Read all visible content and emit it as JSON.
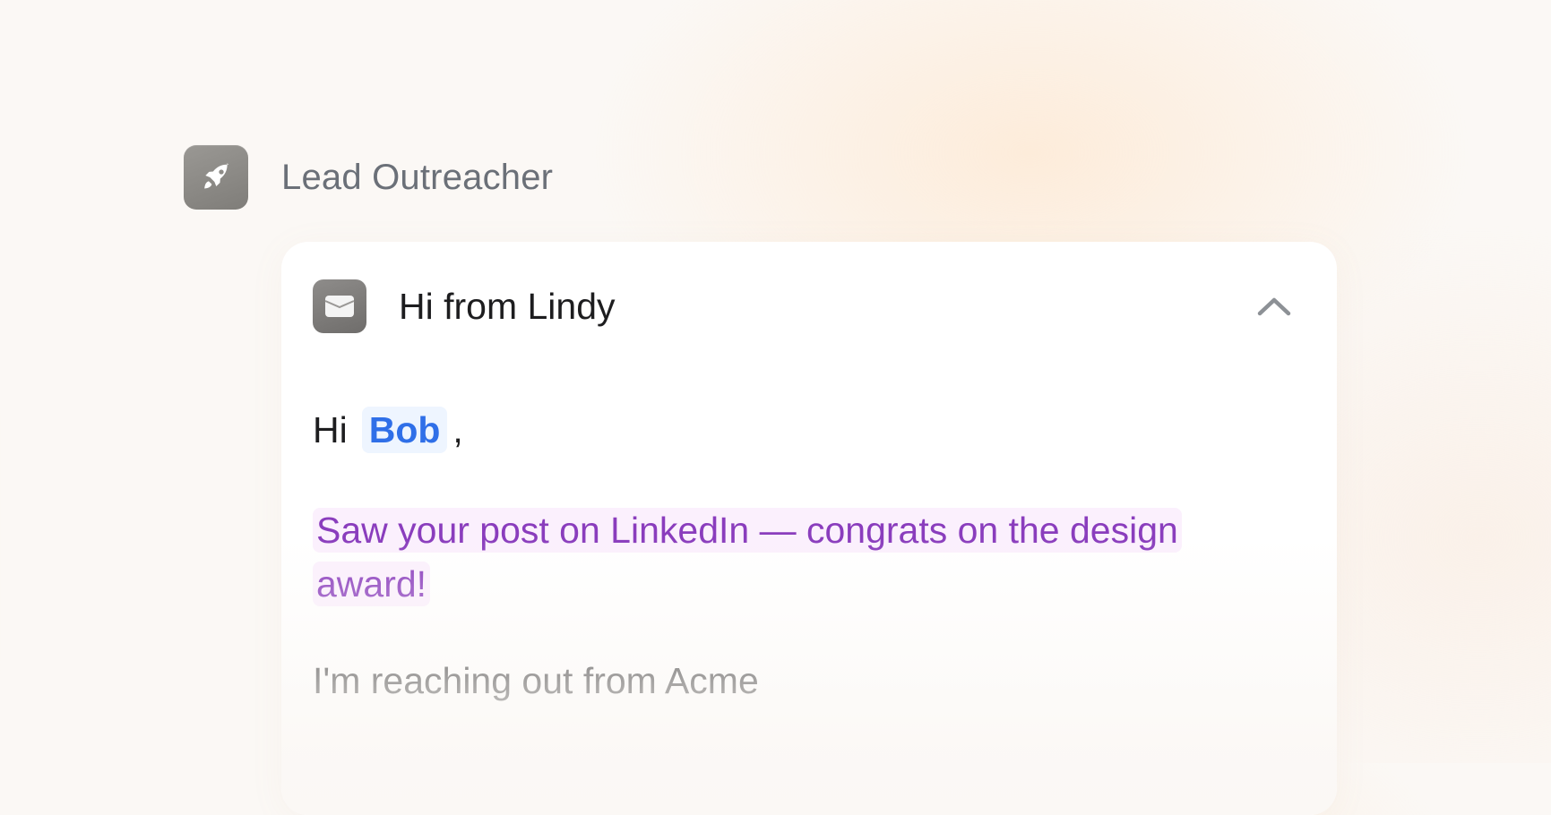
{
  "agent": {
    "name": "Lead Outreacher",
    "icon": "rocket-icon"
  },
  "email": {
    "icon": "envelope-icon",
    "subject": "Hi from Lindy",
    "toggle_icon": "chevron-up-icon",
    "greeting": "Hi",
    "recipient_variable": "Bob",
    "greeting_suffix": ",",
    "personalized_line": "Saw your post on LinkedIn — congrats on the design award!",
    "intro_line": "I'm reaching out from Acme"
  },
  "colors": {
    "variable_text": "#2f6fe8",
    "variable_bg": "#eef5ff",
    "personalized_text": "#8a3dbd",
    "personalized_bg": "#fbf0fd",
    "icon_gray": "#8a8885"
  }
}
